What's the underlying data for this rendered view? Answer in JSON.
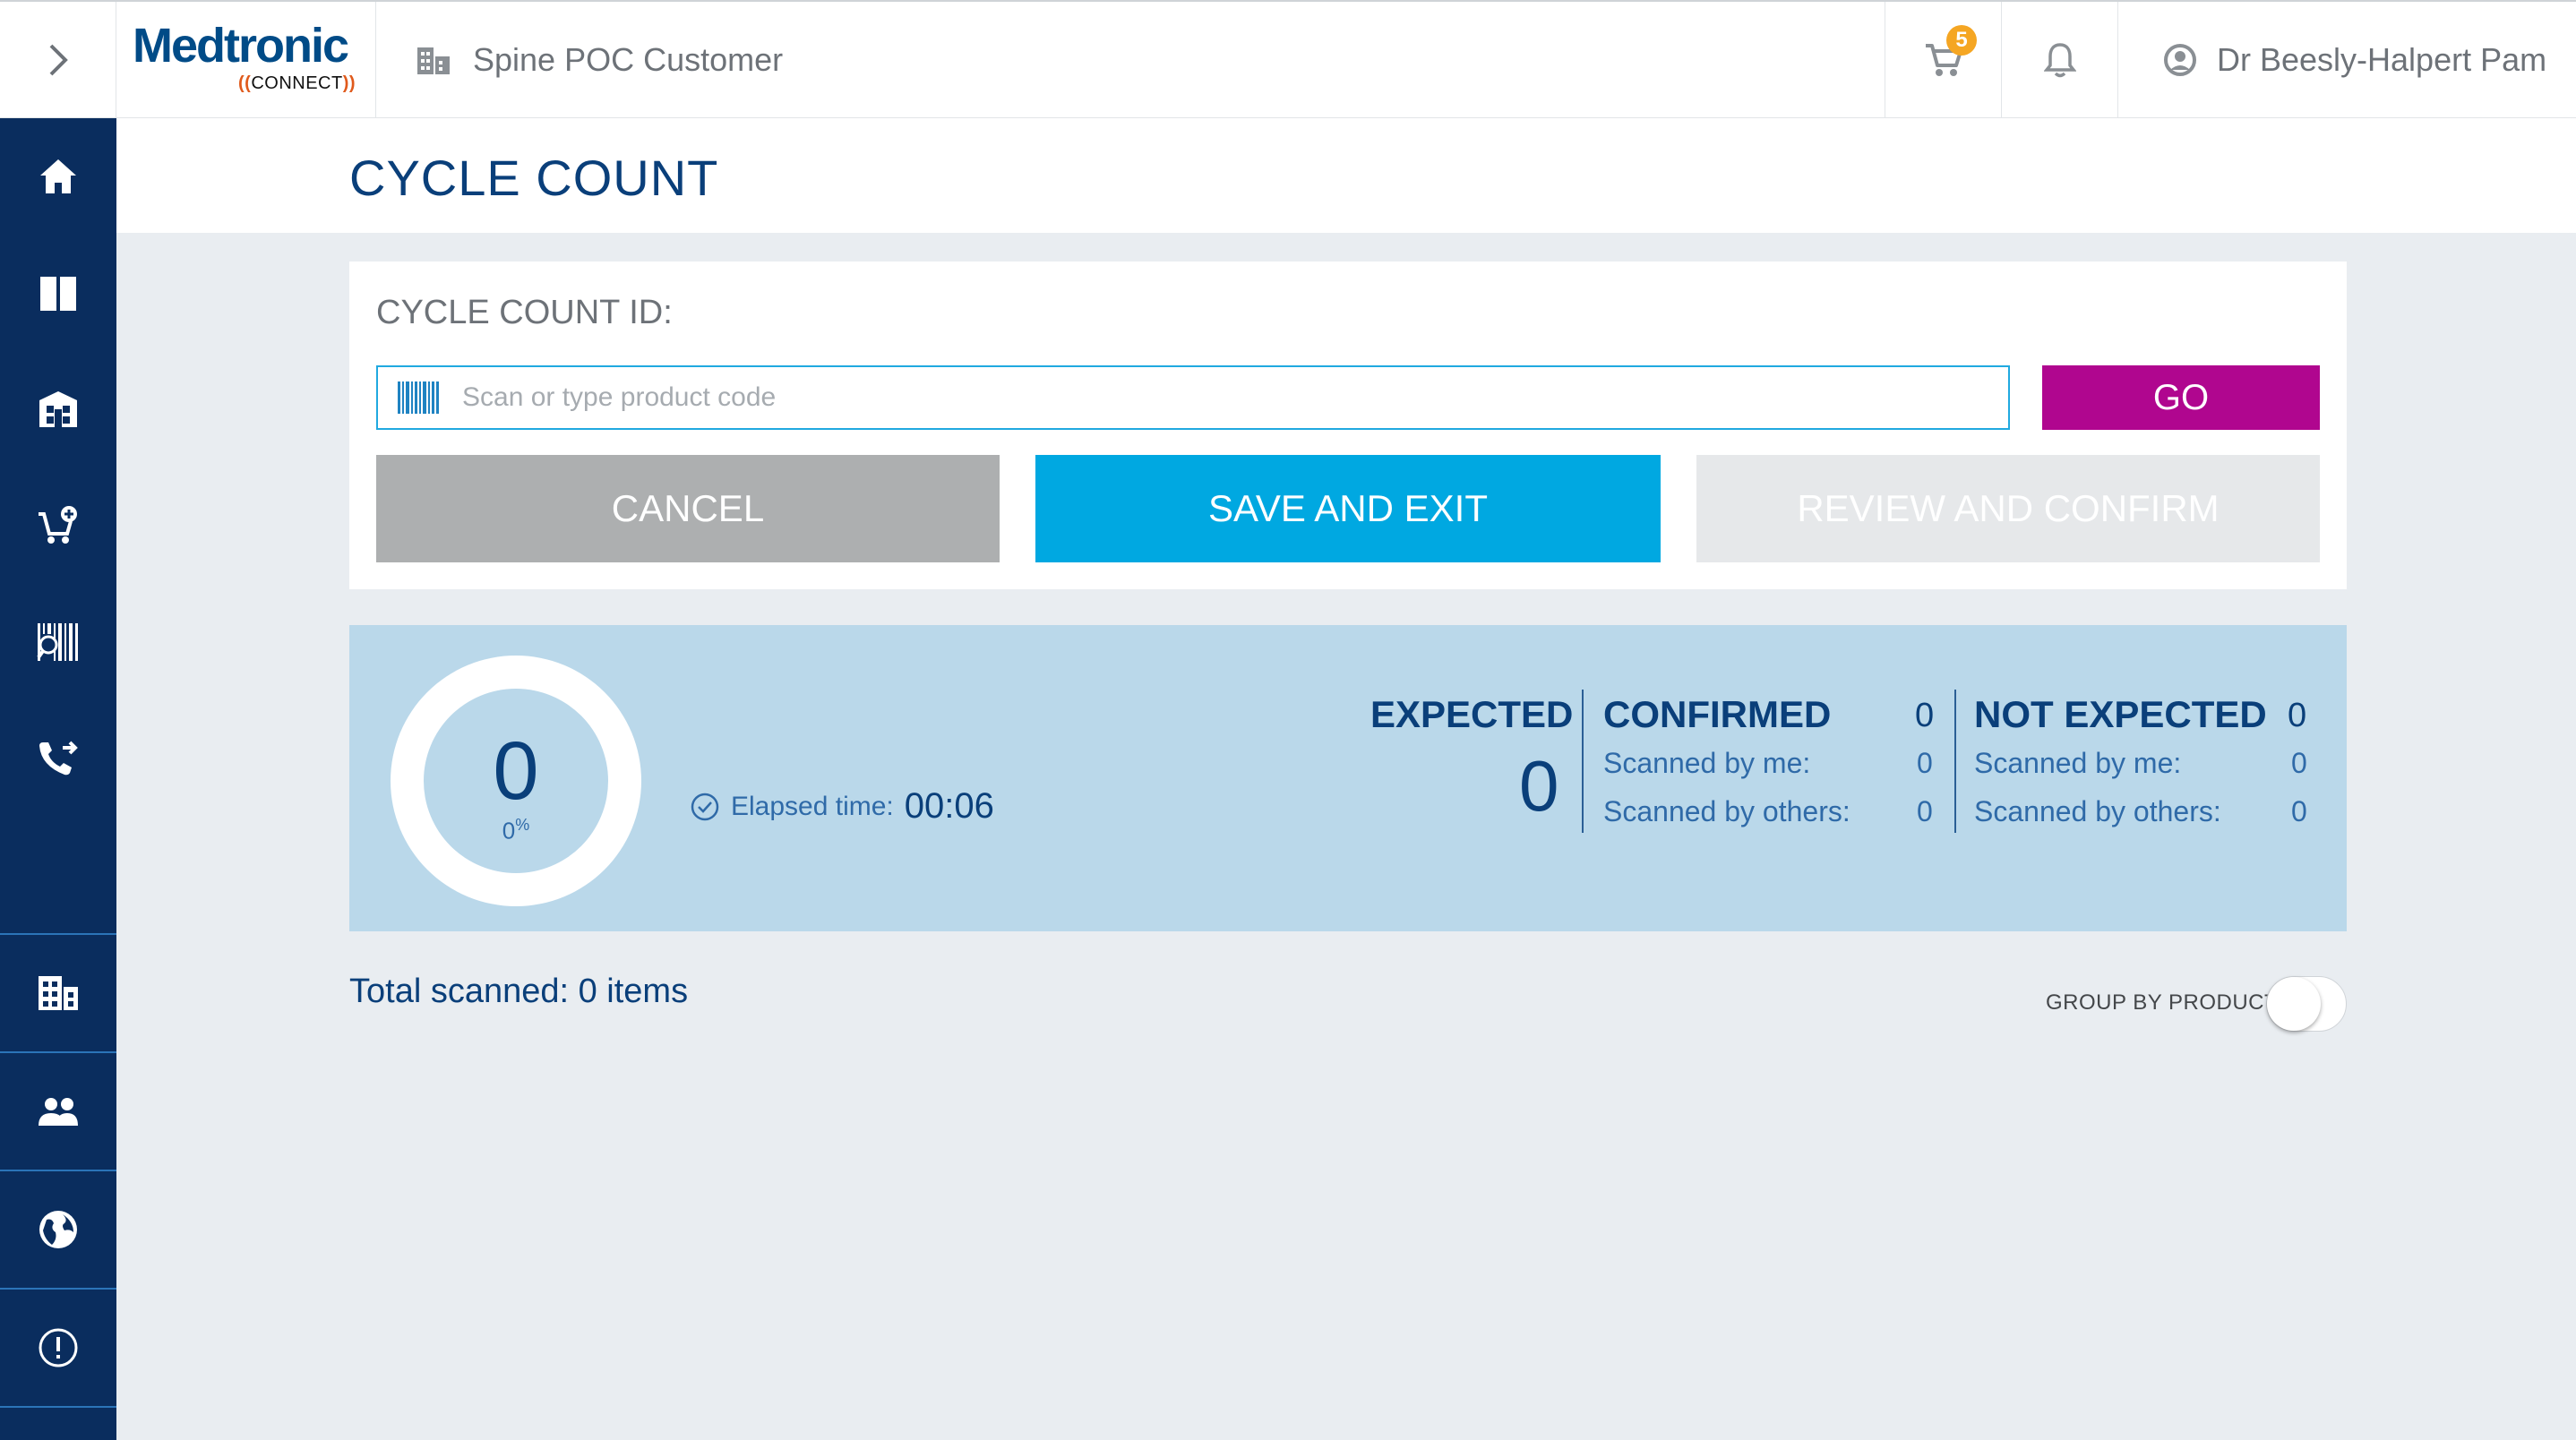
{
  "header": {
    "logo_name": "Medtronic",
    "logo_sub": "CONNECT",
    "customer_name": "Spine POC Customer",
    "cart_count": "5",
    "user_name": "Dr Beesly-Halpert Pam"
  },
  "sidebar": {
    "items": [
      {
        "icon": "home-icon"
      },
      {
        "icon": "book-icon"
      },
      {
        "icon": "warehouse-icon"
      },
      {
        "icon": "cart-add-icon"
      },
      {
        "icon": "barcode-scan-icon"
      },
      {
        "icon": "phone-forward-icon"
      },
      {
        "icon": "building-icon"
      },
      {
        "icon": "people-icon"
      },
      {
        "icon": "globe-icon"
      },
      {
        "icon": "info-icon"
      }
    ]
  },
  "page": {
    "title": "CYCLE COUNT"
  },
  "form": {
    "cycle_count_label": "CYCLE COUNT ID:",
    "scan_placeholder": "Scan or type product code",
    "scan_value": "",
    "go_label": "GO",
    "cancel_label": "CANCEL",
    "save_label": "SAVE AND EXIT",
    "review_label": "REVIEW AND CONFIRM"
  },
  "stats": {
    "progress_count": "0",
    "progress_percent": "0",
    "percent_symbol": "%",
    "elapsed_label": "Elapsed time:",
    "elapsed_value": "00:06",
    "expected": {
      "title": "EXPECTED",
      "value": "0"
    },
    "confirmed": {
      "title": "CONFIRMED",
      "value": "0",
      "scanned_by_me_label": "Scanned by me:",
      "scanned_by_me": "0",
      "scanned_by_others_label": "Scanned by others:",
      "scanned_by_others": "0"
    },
    "not_expected": {
      "title": "NOT EXPECTED",
      "value": "0",
      "scanned_by_me_label": "Scanned by me:",
      "scanned_by_me": "0",
      "scanned_by_others_label": "Scanned by others:",
      "scanned_by_others": "0"
    }
  },
  "footer": {
    "total_scanned": "Total scanned: 0 items",
    "group_by_label": "GROUP BY PRODUCTS",
    "group_by_on": false
  },
  "colors": {
    "sidebar": "#0a2d5e",
    "primary_text": "#0a3f7a",
    "go_button": "#b0068f",
    "save_button": "#00a8e1",
    "cancel_button": "#adafb0",
    "stats_panel": "#bad8ea",
    "badge": "#f5a623"
  }
}
